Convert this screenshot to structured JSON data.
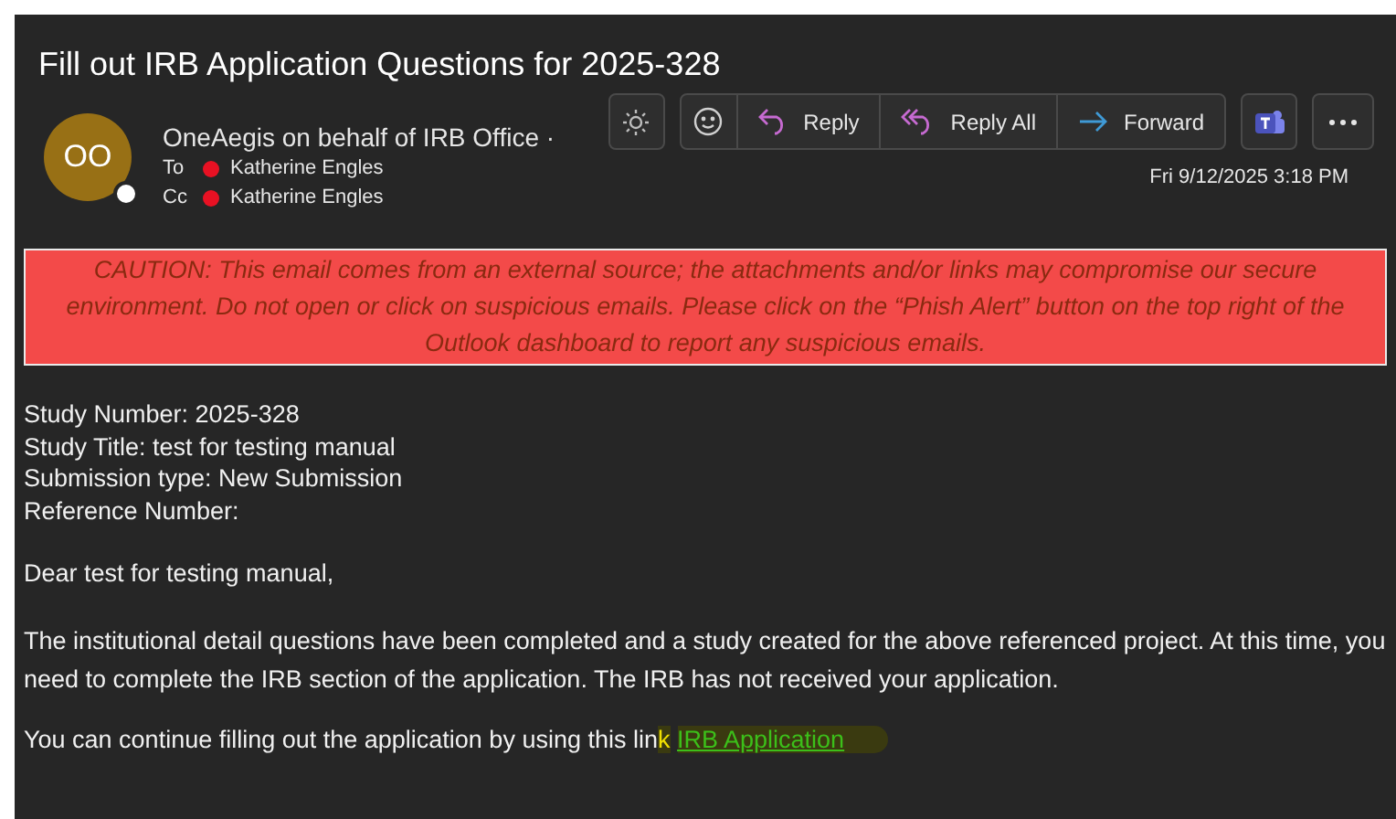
{
  "subject": "Fill out IRB Application Questions for 2025-328",
  "sender": {
    "avatar_initials": "OO",
    "name": "OneAegis on behalf of IRB Office ·"
  },
  "recipients": [
    {
      "label": "To",
      "name": "Katherine Engles",
      "color": "#e81123"
    },
    {
      "label": "Cc",
      "name": "Katherine Engles",
      "color": "#e81123"
    }
  ],
  "toolbar": {
    "actions": [
      {
        "kind": "reply",
        "label": "Reply"
      },
      {
        "kind": "reply_all",
        "label": "Reply All"
      },
      {
        "kind": "forward",
        "label": "Forward"
      }
    ]
  },
  "date": "Fri 9/12/2025 3:18 PM",
  "caution": "CAUTION: This email comes from an external source; the attachments and/or links may compromise our secure environment. Do not open or click on suspicious emails. Please click on the “Phish Alert” button on the top right of the Outlook dashboard to report any suspicious emails.",
  "details": [
    "Study Number: 2025-328",
    "Study Title: test for testing manual",
    "Submission type: New Submission",
    "Reference Number:"
  ],
  "greeting": "Dear test for testing manual,",
  "paragraph": "The institutional detail questions have been completed and a study created for the above referenced project. At this time, you need to complete the IRB section of the application. The IRB has not received your application.",
  "link_sentence": {
    "text": "You can continue filling out the application by using this lin",
    "highlighted": "k",
    "link": "IRB Application"
  }
}
